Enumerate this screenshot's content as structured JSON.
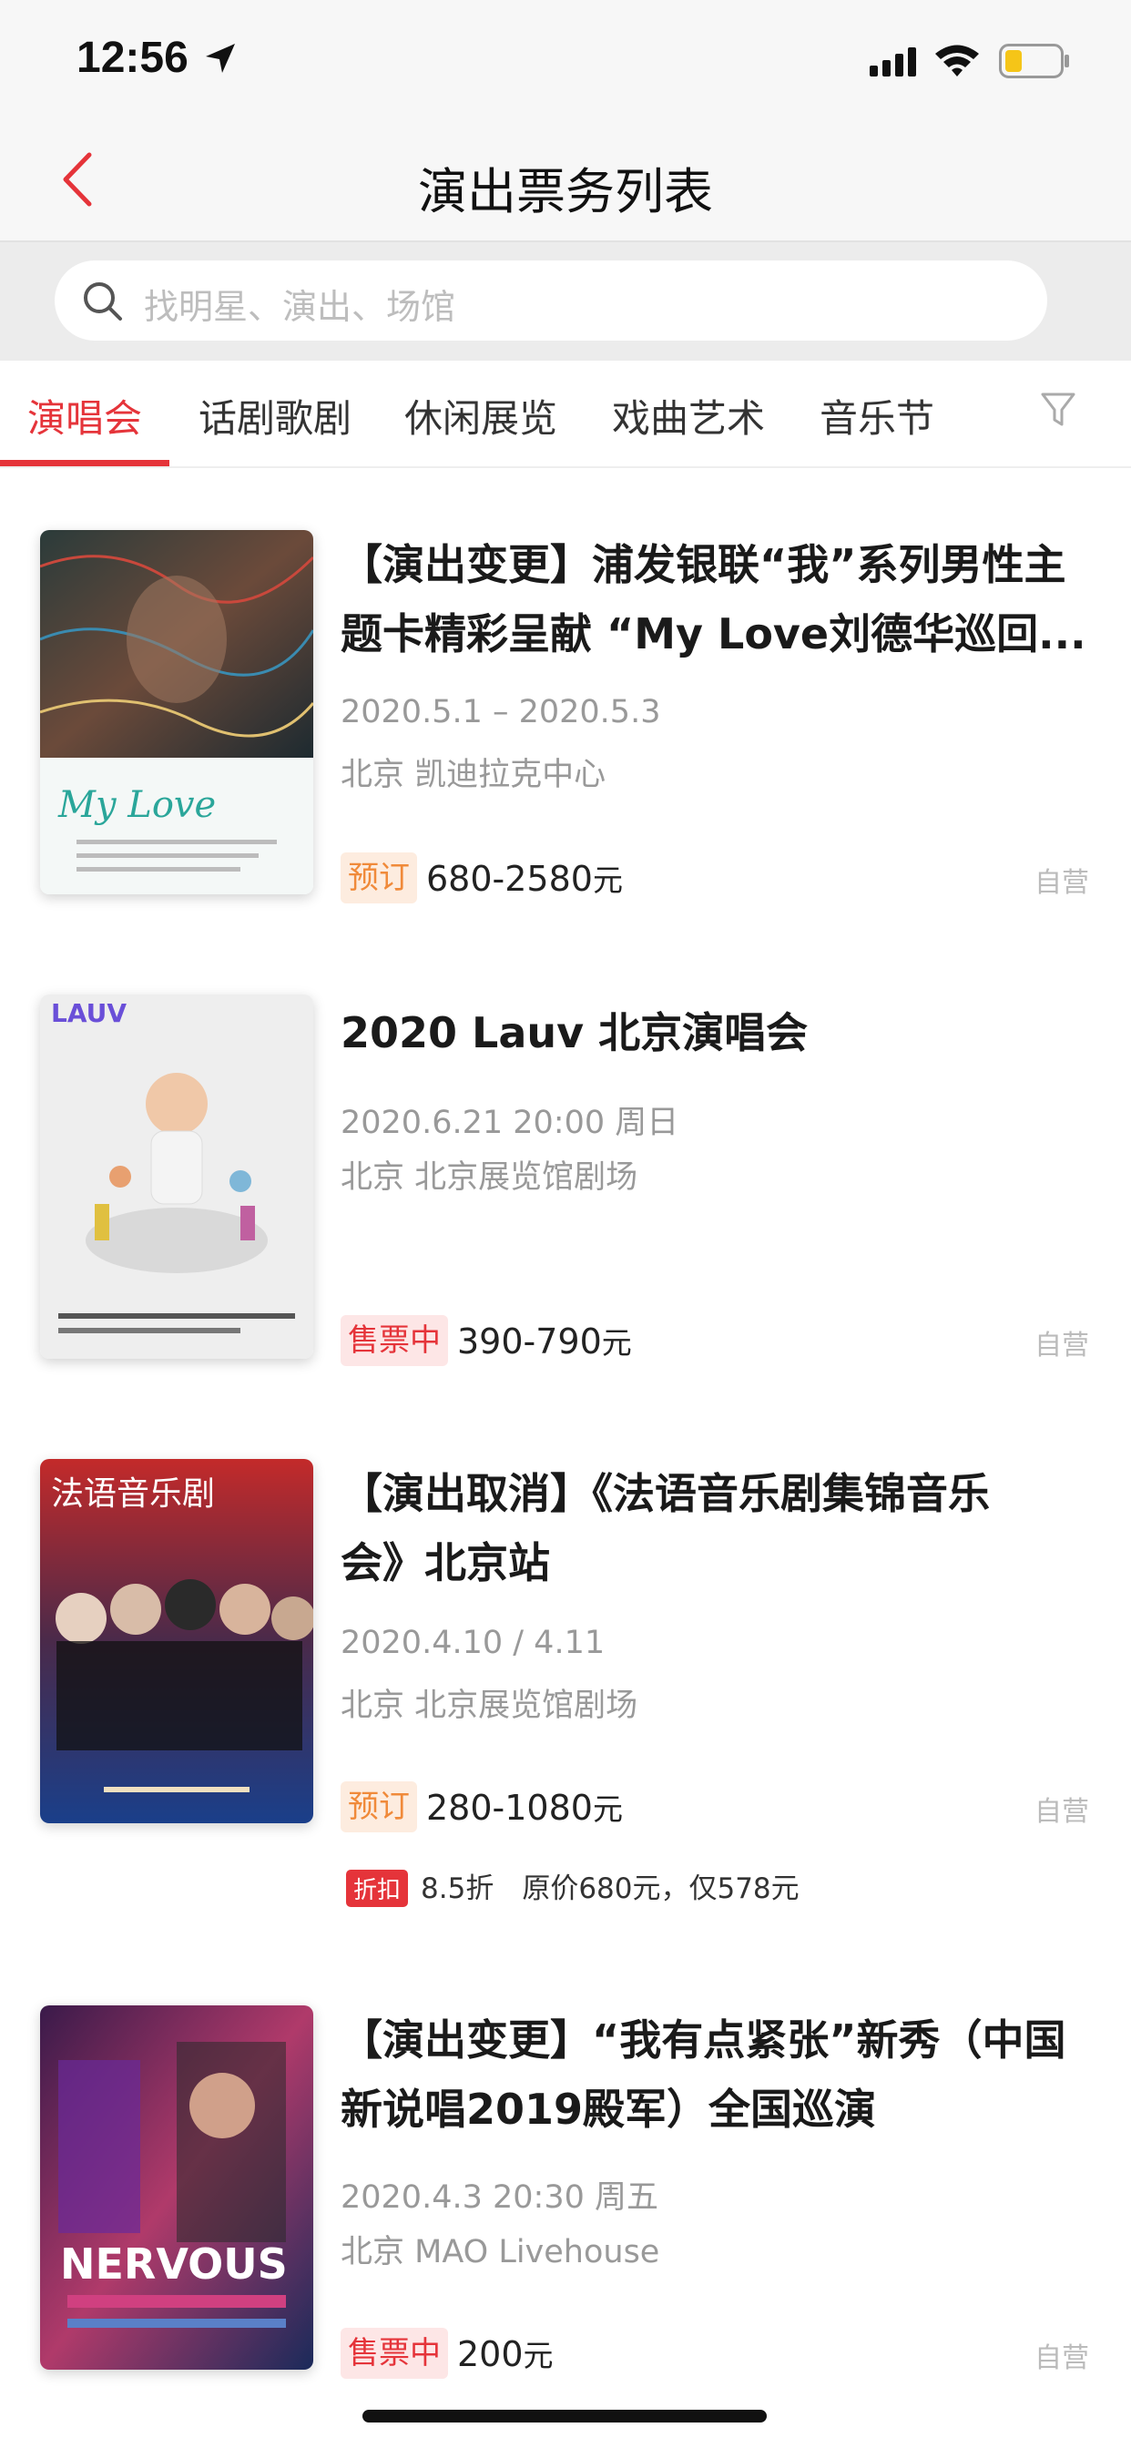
{
  "status_bar": {
    "time": "12:56"
  },
  "nav": {
    "title": "演出票务列表"
  },
  "search": {
    "placeholder": "找明星、演出、场馆"
  },
  "tabs": [
    {
      "label": "演唱会",
      "active": true
    },
    {
      "label": "话剧歌剧",
      "active": false
    },
    {
      "label": "休闲展览",
      "active": false
    },
    {
      "label": "戏曲艺术",
      "active": false
    },
    {
      "label": "音乐节",
      "active": false
    }
  ],
  "items": [
    {
      "title_line1": "【演出变更】浦发银联“我”系列男性主",
      "title_line2": "题卡精彩呈献 “My Love刘德华巡回...",
      "date": "2020.5.1 – 2020.5.3",
      "venue": "北京 凯迪拉克中心",
      "badge": "预订",
      "price": "680-2580",
      "unit": "元",
      "self": "自营",
      "poster_text": "My Love"
    },
    {
      "title_line1": "2020 Lauv 北京演唱会",
      "date": "2020.6.21 20:00 周日",
      "venue": "北京 北京展览馆剧场",
      "badge": "售票中",
      "price": "390-790",
      "unit": "元",
      "self": "自营",
      "poster_text": "LAUV"
    },
    {
      "title_line1": "【演出取消】《法语音乐剧集锦音乐",
      "title_line2": "会》北京站",
      "date": "2020.4.10 / 4.11",
      "venue": "北京 北京展览馆剧场",
      "badge": "预订",
      "price": "280-1080",
      "unit": "元",
      "self": "自营",
      "discount_tag": "折扣",
      "discount_text": "8.5折　原价680元，仅578元",
      "poster_text": "法语音乐剧"
    },
    {
      "title_line1": "【演出变更】“我有点紧张”新秀（中国",
      "title_line2": "新说唱2019殿军）全国巡演",
      "date": "2020.4.3 20:30 周五",
      "venue": "北京 MAO Livehouse",
      "badge": "售票中",
      "price": "200",
      "unit": "元",
      "self": "自营",
      "poster_text": "NERVOUS"
    }
  ],
  "colors": {
    "accent": "#e5343a",
    "orange": "#f08a3a",
    "muted": "#999999"
  }
}
